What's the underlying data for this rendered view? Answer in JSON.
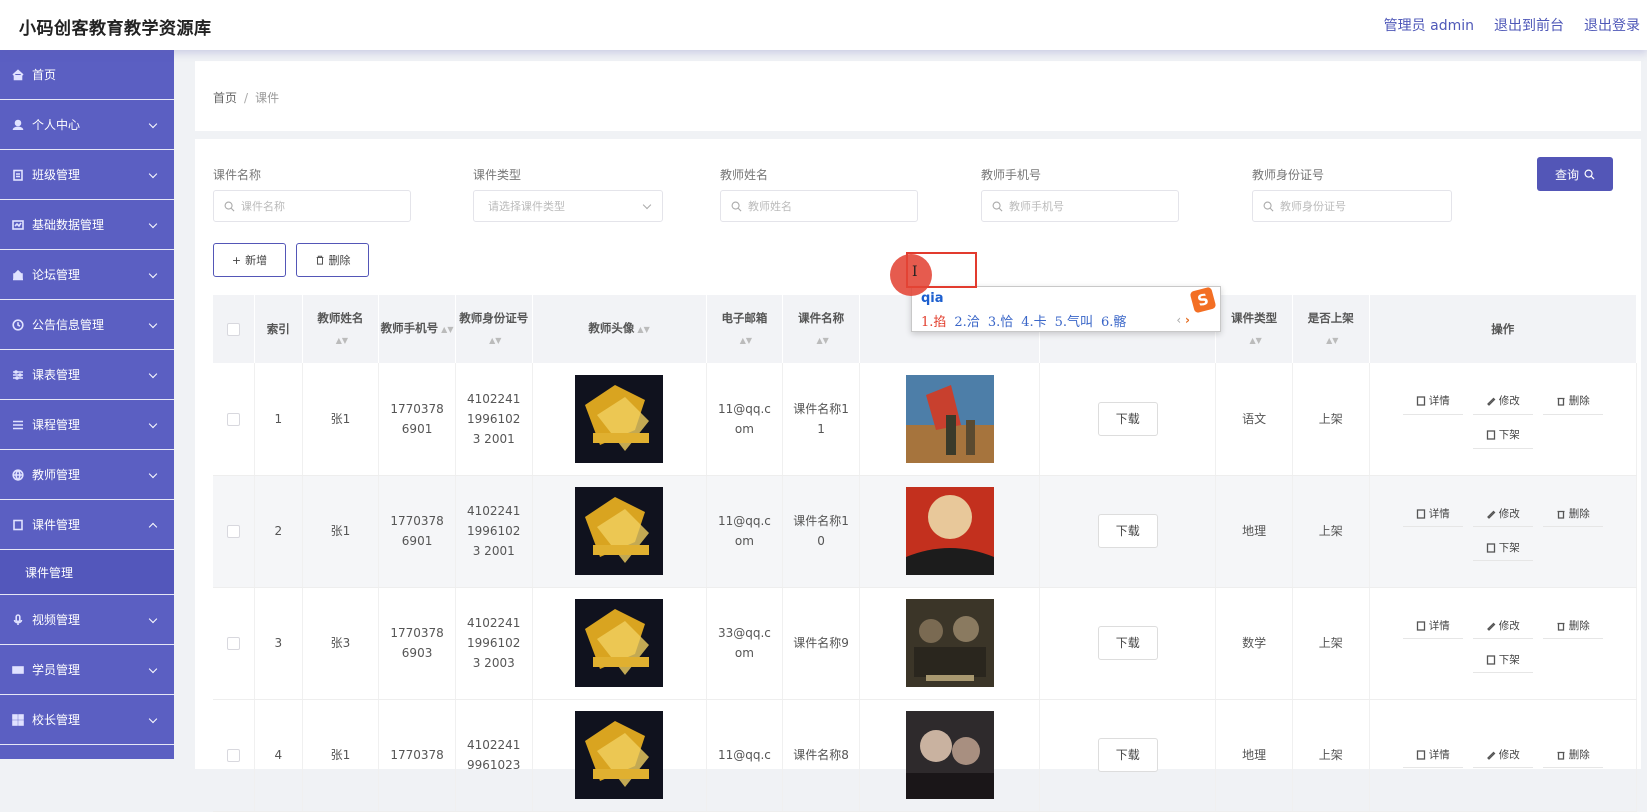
{
  "header": {
    "app_title": "小码创客教育教学资源库",
    "admin_label": "管理员 admin",
    "to_front": "退出到前台",
    "logout": "退出登录"
  },
  "sidebar": {
    "items": [
      {
        "label": "首页",
        "icon": "home-icon"
      },
      {
        "label": "个人中心",
        "icon": "user-icon"
      },
      {
        "label": "班级管理",
        "icon": "clipboard-icon"
      },
      {
        "label": "基础数据管理",
        "icon": "data-icon"
      },
      {
        "label": "论坛管理",
        "icon": "forum-icon"
      },
      {
        "label": "公告信息管理",
        "icon": "clock-icon"
      },
      {
        "label": "课表管理",
        "icon": "sliders-icon"
      },
      {
        "label": "课程管理",
        "icon": "list-icon"
      },
      {
        "label": "教师管理",
        "icon": "globe-icon"
      },
      {
        "label": "课件管理",
        "icon": "file-icon"
      },
      {
        "label": "视频管理",
        "icon": "mic-icon"
      },
      {
        "label": "学员管理",
        "icon": "students-icon"
      },
      {
        "label": "校长管理",
        "icon": "grid-icon"
      }
    ],
    "submenu": {
      "label": "课件管理"
    }
  },
  "breadcrumb": {
    "home": "首页",
    "separator": "/",
    "current": "课件"
  },
  "filters": {
    "course_name": {
      "label": "课件名称",
      "placeholder": "课件名称"
    },
    "course_type": {
      "label": "课件类型",
      "placeholder": "请选择课件类型"
    },
    "teacher_name": {
      "label": "教师姓名",
      "placeholder": "教师姓名"
    },
    "teacher_phone": {
      "label": "教师手机号",
      "placeholder": "教师手机号"
    },
    "teacher_id": {
      "label": "教师身份证号",
      "placeholder": "教师身份证号"
    },
    "query_button": "查询"
  },
  "actions": {
    "add": "新增",
    "delete": "删除"
  },
  "table": {
    "headers": {
      "index": "索引",
      "teacher_name": "教师姓名",
      "teacher_phone": "教师手机号",
      "teacher_id": "教师身份证号",
      "avatar": "教师头像",
      "email": "电子邮箱",
      "course_name": "课件名称",
      "course_type": "课件类型",
      "on_shelf": "是否上架",
      "ops": "操作"
    },
    "rows": [
      {
        "index": "1",
        "name": "张1",
        "phone": "17703786901",
        "id_no": "410224119961023 2001",
        "email": "11@qq.com",
        "course": "课件名称11",
        "download": "下载",
        "type": "语文",
        "shelf": "上架"
      },
      {
        "index": "2",
        "name": "张1",
        "phone": "17703786901",
        "id_no": "410224119961023 2001",
        "email": "11@qq.com",
        "course": "课件名称10",
        "download": "下载",
        "type": "地理",
        "shelf": "上架"
      },
      {
        "index": "3",
        "name": "张3",
        "phone": "17703786903",
        "id_no": "410224119961023 2003",
        "email": "33@qq.com",
        "course": "课件名称9",
        "download": "下载",
        "type": "数学",
        "shelf": "上架"
      },
      {
        "index": "4",
        "name": "张1",
        "phone": "1770378",
        "id_no": "4102241 9961023",
        "email": "11@qq.c",
        "course": "课件名称8",
        "download": "下载",
        "type": "地理",
        "shelf": "上架"
      }
    ],
    "op_labels": {
      "detail": "详情",
      "edit": "修改",
      "remove": "删除",
      "unshelve": "下架"
    }
  },
  "ime": {
    "input": "qia",
    "candidates": [
      "1.掐",
      "2.洽",
      "3.恰",
      "4.卡",
      "5.气叫",
      "6.髂"
    ]
  },
  "colors": {
    "sidebar": "#5b5fc2",
    "accent": "#5356b7",
    "ime_highlight": "#e23c2b"
  }
}
